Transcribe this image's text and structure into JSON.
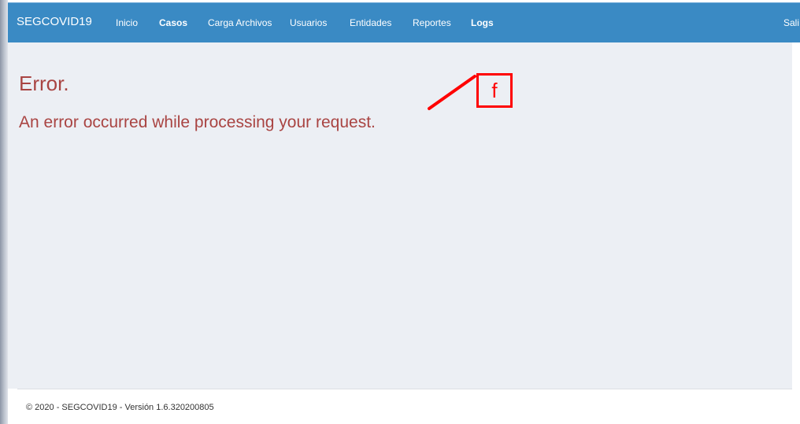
{
  "navbar": {
    "brand": "SEGCOVID19",
    "links": [
      {
        "label": "Inicio",
        "bold": false
      },
      {
        "label": "Casos",
        "bold": true
      },
      {
        "label": "Carga Archivos",
        "bold": false
      },
      {
        "label": "Usuarios",
        "bold": false
      },
      {
        "label": "Entidades",
        "bold": false
      },
      {
        "label": "Reportes",
        "bold": false
      },
      {
        "label": "Logs",
        "bold": true
      }
    ],
    "logout_label": "Sali"
  },
  "error": {
    "title": "Error.",
    "message": "An error occurred while processing your request."
  },
  "annotation": {
    "letter": "f",
    "color": "#ff0000"
  },
  "footer": {
    "text": "© 2020 - SEGCOVID19 - Versión 1.6.320200805"
  },
  "colors": {
    "navbar": "#3a8ac4",
    "error_text": "#a94442",
    "content_bg": "#eceff4"
  }
}
